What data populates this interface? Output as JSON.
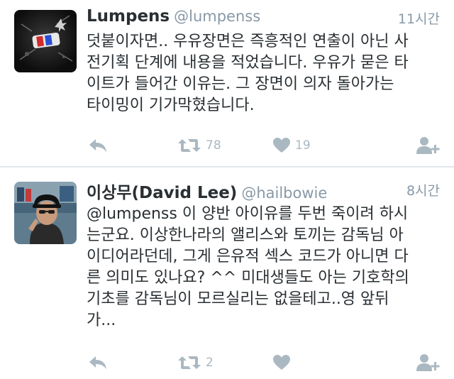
{
  "tweets": [
    {
      "name": "Lumpens",
      "handle": "@lumpenss",
      "time": "11시간",
      "lines": [
        "덧붙이자면.. 우유장면은 즉흥적인 연출이 아닌 사",
        "전기획 단계에 내용을 적었습니다. 우유가 묻은 타",
        "이트가 들어간 이유는. 그 장면이 의자 돌아가는",
        "타이밍이 기가막혔습니다."
      ],
      "retweets": "78",
      "likes": "19"
    },
    {
      "name": "이상무(David Lee)",
      "handle": "@hailbowie",
      "time": "8시간",
      "lines": [
        "@lumpenss 이 양반 아이유를 두번 죽이려 하시",
        "는군요. 이상한나라의 앨리스와 토끼는 감독님 아",
        "이디어라던데, 그게 은유적 섹스 코드가 아니면 다",
        "른 의미도 있나요? ^^ 미대생들도 아는 기호학의",
        "기초를 감독님이 모르실리는 없을테고..영 앞뒤",
        "가..."
      ],
      "retweets": "2",
      "likes": ""
    }
  ],
  "icons": {
    "reply": "reply-arrow-icon",
    "retweet": "retweet-icon",
    "like": "heart-icon",
    "follow": "follow-person-icon"
  },
  "colors": {
    "text": "#292f33",
    "meta": "#8899a6",
    "action_icon": "#aab8c2",
    "divider": "#e1e8ed"
  }
}
